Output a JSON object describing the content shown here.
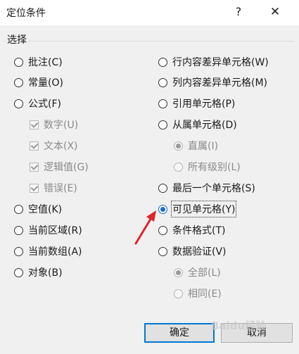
{
  "window": {
    "title": "定位条件",
    "help": "?",
    "close": "✕"
  },
  "group_label": "选择",
  "left": {
    "comments": "批注(C)",
    "constants": "常量(O)",
    "formulas": "公式(F)",
    "numbers": "数字(U)",
    "text": "文本(X)",
    "logicals": "逻辑值(G)",
    "errors": "错误(E)",
    "blanks": "空值(K)",
    "current_region": "当前区域(R)",
    "current_array": "当前数组(A)",
    "objects": "对象(B)"
  },
  "right": {
    "row_diff": "行内容差异单元格(W)",
    "col_diff": "列内容差异单元格(M)",
    "precedents": "引用单元格(P)",
    "dependents": "从属单元格(D)",
    "direct_only": "直属(I)",
    "all_levels": "所有级别(L)",
    "last_cell": "最后一个单元格(S)",
    "visible_cells": "可见单元格(Y)",
    "conditional_formats": "条件格式(T)",
    "data_validation": "数据验证(V)",
    "all": "全部(L)",
    "same": "相同(E)"
  },
  "selected_option": "可见单元格(Y)",
  "buttons": {
    "ok": "确定",
    "cancel": "取消"
  },
  "watermark": "Baidu经验",
  "colors": {
    "accent": "#0078d7",
    "arrow": "#e0242b"
  }
}
